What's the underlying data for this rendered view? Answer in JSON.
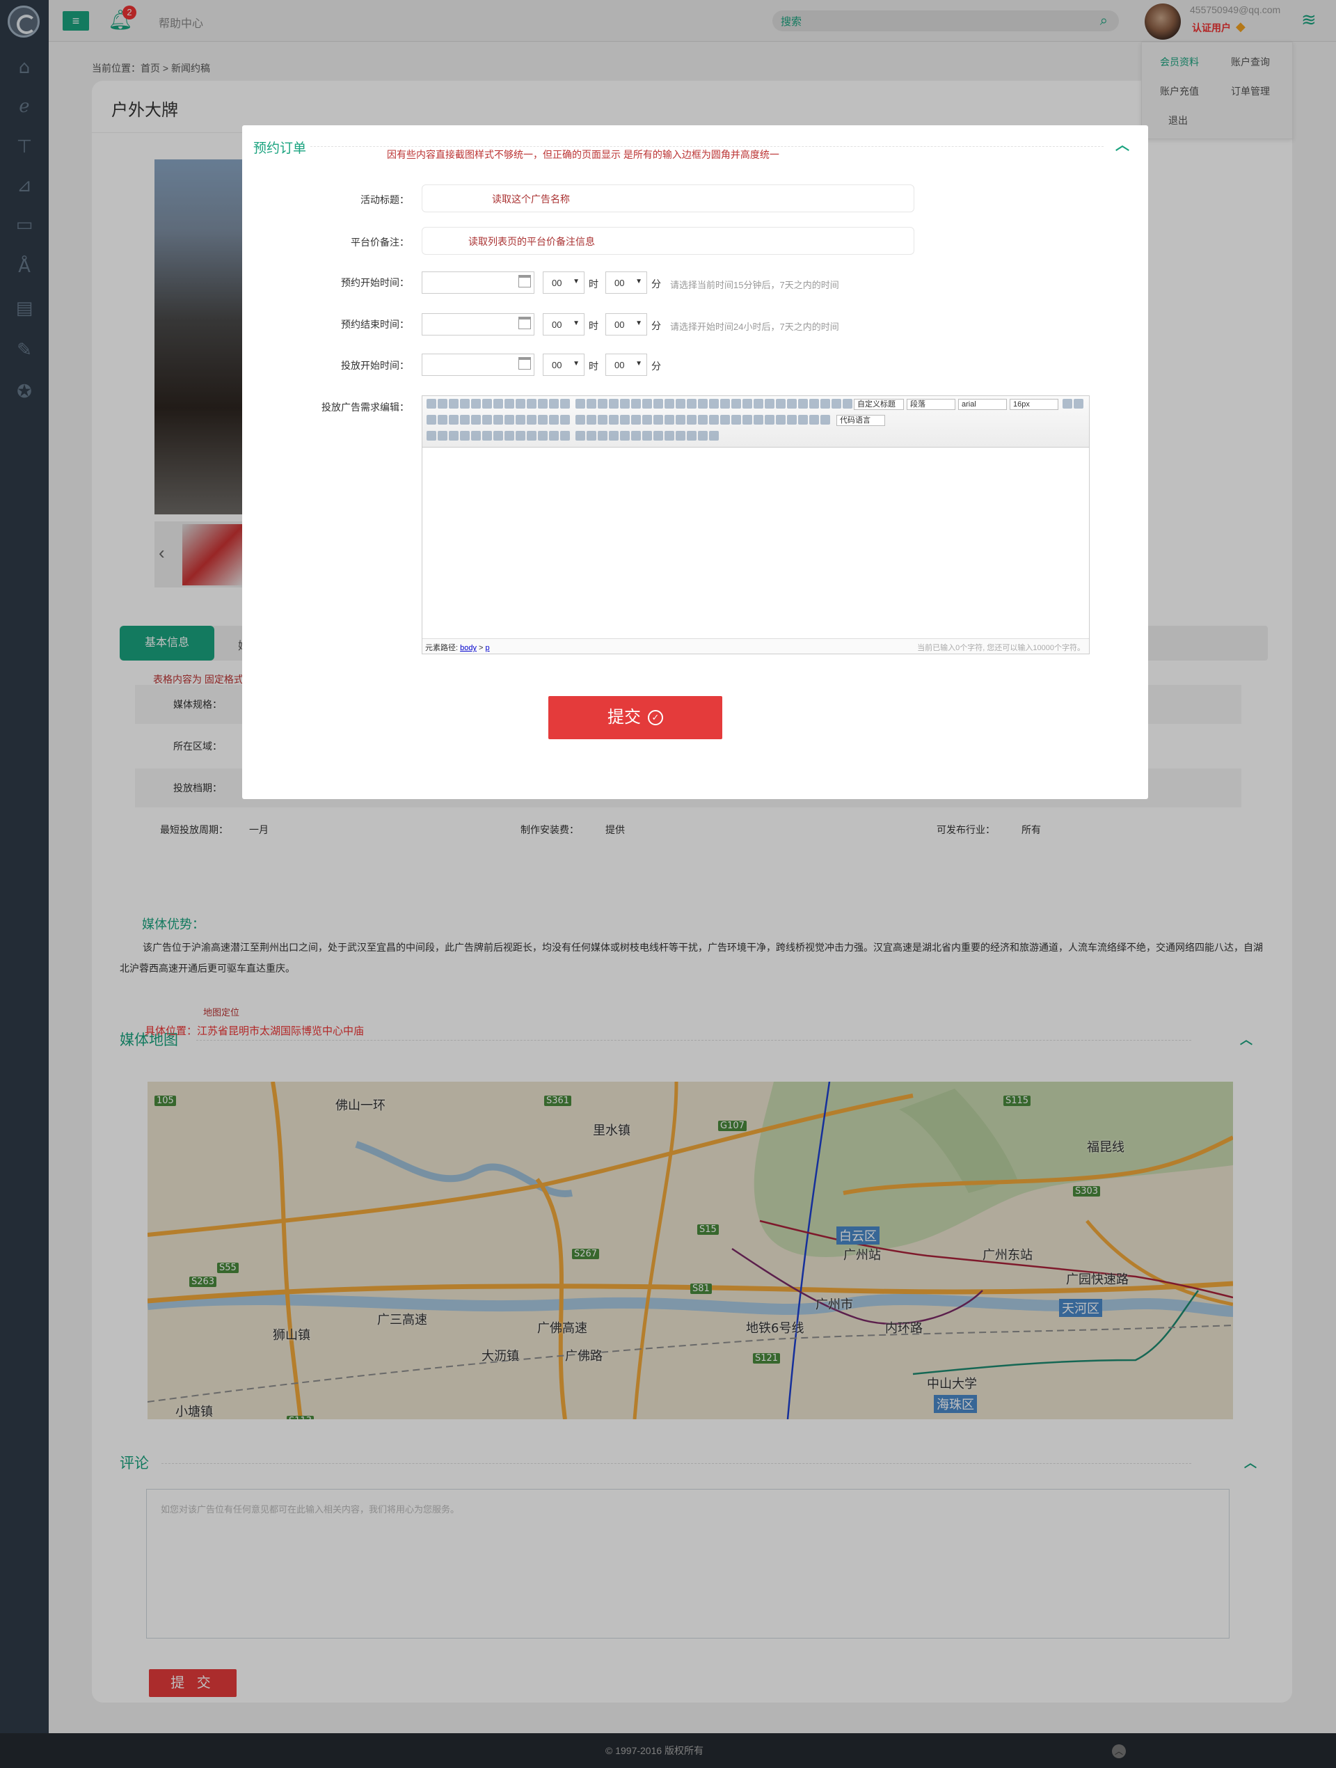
{
  "topbar": {
    "menu_icon": "≡",
    "notification_count": "2",
    "help": "帮助中心",
    "search_placeholder": "搜索",
    "email": "455750949@qq.com",
    "certified": "认证用户"
  },
  "user_menu": [
    "会员资料",
    "账户查询",
    "账户充值",
    "订单管理",
    "退出"
  ],
  "breadcrumb": "当前位置：首页 > 新闻约稿",
  "page_title": "户外大牌",
  "tabs": [
    "基本信息",
    "媒"
  ],
  "table_note": "表格内容为 固定格式",
  "info_rows": [
    {
      "label": "媒体规格："
    },
    {
      "label": "所在区域："
    },
    {
      "label": "投放档期："
    },
    {
      "label": "最短投放周期：",
      "value": "一月",
      "label2": "制作安装费：",
      "value2": "提供",
      "label3": "可发布行业：",
      "value3": "所有"
    }
  ],
  "advantage": {
    "title": "媒体优势：",
    "text": "该广告位于沪渝高速潜江至荆州出口之间，处于武汉至宜昌的中间段，此广告牌前后视距长，均没有任何媒体或树枝电线杆等干扰，广告环境干净，跨线桥视觉冲击力强。汉宜高速是湖北省内重要的经济和旅游通道，人流车流络绎不绝，交通网络四能八达，自湖北沪蓉西高速开通后更可驱车直达重庆。"
  },
  "map_section": {
    "title": "媒体地图",
    "tag": "地图定位",
    "address": "具体位置：江苏省昆明市太湖国际博览中心中庙",
    "labels": [
      "里水镇",
      "广州市",
      "白云区",
      "广州站",
      "广州东站",
      "天河区",
      "中山大学",
      "海珠区",
      "狮山镇",
      "大沥镇",
      "小塘镇",
      "广三高速",
      "广佛高速",
      "广佛路",
      "地铁6号线",
      "内环路",
      "广园快速路",
      "福昆线",
      "佛山一环",
      "G107",
      "S15",
      "S303",
      "S115",
      "S81",
      "S263",
      "S55",
      "S267",
      "S121",
      "S113",
      "S361",
      "105"
    ]
  },
  "comment": {
    "title": "评论",
    "placeholder": "如您对该广告位有任何意见都可在此输入相关内容，我们将用心为您服务。",
    "submit": "提 交"
  },
  "footer": "© 1997-2016 版权所有",
  "modal": {
    "title": "预约订单",
    "note": "因有些内容直接截图样式不够统一，但正确的页面显示 是所有的输入边框为圆角并高度统一",
    "activity_label": "活动标题：",
    "activity_value": "读取这个广告名称",
    "price_label": "平台价备注：",
    "price_value": "读取列表页的平台价备注信息",
    "start_label": "预约开始时间：",
    "end_label": "预约结束时间：",
    "launch_label": "投放开始时间：",
    "hour_default": "00",
    "minute_default": "00",
    "hour_unit": "时",
    "minute_unit": "分",
    "start_hint": "请选择当前时间15分钟后，7天之内的时间",
    "end_hint": "请选择开始时间24小时后，7天之内的时间",
    "editor_label": "投放广告需求编辑：",
    "editor_dropdowns": [
      "自定义标题",
      "段落",
      "arial",
      "16px",
      "代码语言"
    ],
    "editor_path_label": "元素路径:",
    "editor_path_body": "body",
    "editor_path_sep": ">",
    "editor_path_p": "p",
    "editor_count": "当前已输入0个字符, 您还可以输入10000个字符。",
    "submit": "提交"
  }
}
